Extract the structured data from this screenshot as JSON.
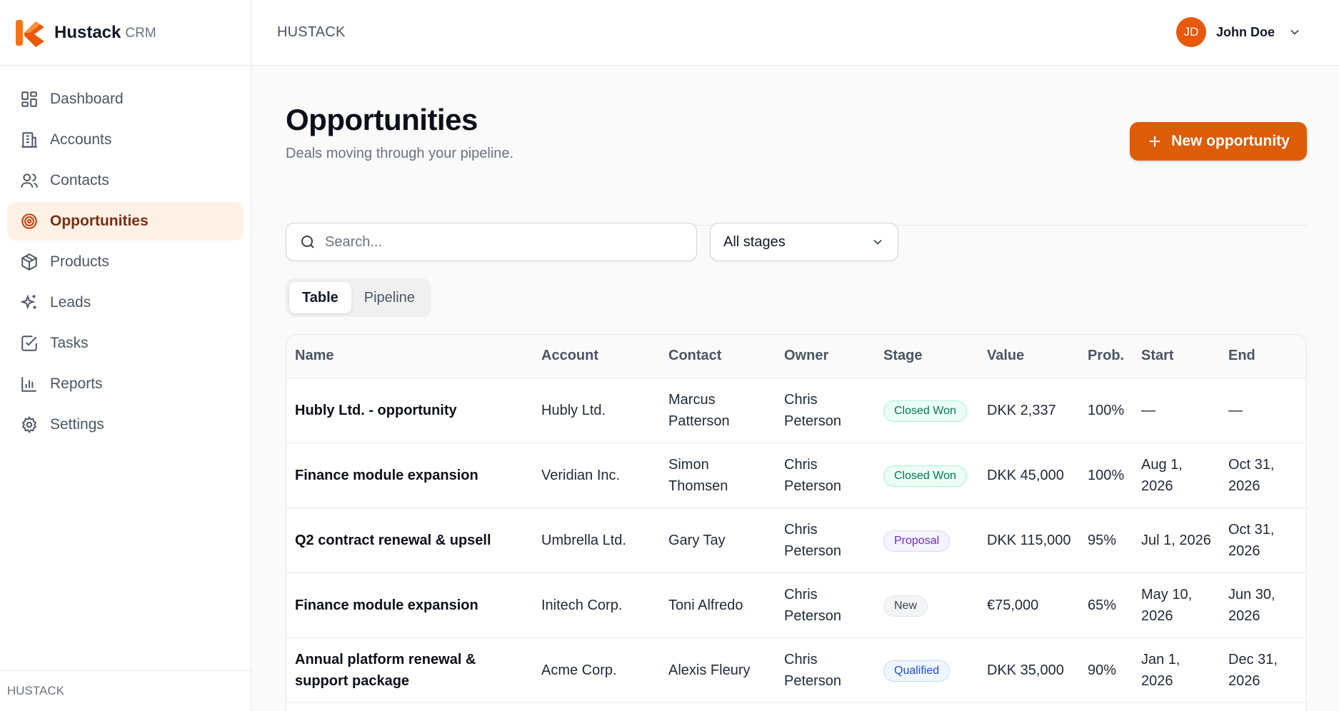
{
  "brand": {
    "name": "Hustack",
    "suffix": "CRM",
    "accent": "#EA580C"
  },
  "sidebar": {
    "items": [
      {
        "label": "Dashboard",
        "icon": "dashboard-icon"
      },
      {
        "label": "Accounts",
        "icon": "building-icon"
      },
      {
        "label": "Contacts",
        "icon": "users-icon"
      },
      {
        "label": "Opportunities",
        "icon": "target-icon",
        "active": true
      },
      {
        "label": "Products",
        "icon": "box-icon"
      },
      {
        "label": "Leads",
        "icon": "sparkles-icon"
      },
      {
        "label": "Tasks",
        "icon": "checkbox-icon"
      },
      {
        "label": "Reports",
        "icon": "bar-chart-icon"
      },
      {
        "label": "Settings",
        "icon": "gear-icon"
      }
    ],
    "footer": "HUSTACK"
  },
  "header": {
    "title": "HUSTACK",
    "user": {
      "initials": "JD",
      "name": "John Doe"
    }
  },
  "page": {
    "title": "Opportunities",
    "subtitle": "Deals moving through your pipeline.",
    "new_button": "New opportunity"
  },
  "filters": {
    "search_placeholder": "Search...",
    "stage_selected": "All stages"
  },
  "view_toggle": {
    "options": [
      "Table",
      "Pipeline"
    ],
    "active": "Table"
  },
  "table": {
    "columns": [
      "Name",
      "Account",
      "Contact",
      "Owner",
      "Stage",
      "Value",
      "Prob.",
      "Start",
      "End"
    ],
    "rows": [
      {
        "name": "Hubly Ltd. - opportunity",
        "account": "Hubly Ltd.",
        "contact": "Marcus Patterson",
        "owner": "Chris Peterson",
        "stage": "Closed Won",
        "value": "DKK 2,337",
        "prob": "100%",
        "start": "—",
        "end": "—"
      },
      {
        "name": "Finance module expansion",
        "account": "Veridian Inc.",
        "contact": "Simon Thomsen",
        "owner": "Chris Peterson",
        "stage": "Closed Won",
        "value": "DKK 45,000",
        "prob": "100%",
        "start": "Aug 1, 2026",
        "end": "Oct 31, 2026"
      },
      {
        "name": "Q2 contract renewal & upsell",
        "account": "Umbrella Ltd.",
        "contact": "Gary Tay",
        "owner": "Chris Peterson",
        "stage": "Proposal",
        "value": "DKK 115,000",
        "prob": "95%",
        "start": "Jul 1, 2026",
        "end": "Oct 31, 2026"
      },
      {
        "name": "Finance module expansion",
        "account": "Initech Corp.",
        "contact": "Toni Alfredo",
        "owner": "Chris Peterson",
        "stage": "New",
        "value": "€75,000",
        "prob": "65%",
        "start": "May 10, 2026",
        "end": "Jun 30, 2026"
      },
      {
        "name": "Annual platform renewal & support package",
        "account": "Acme Corp.",
        "contact": "Alexis Fleury",
        "owner": "Chris Peterson",
        "stage": "Qualified",
        "value": "DKK 35,000",
        "prob": "90%",
        "start": "Jan 1, 2026",
        "end": "Dec 31, 2026"
      }
    ]
  }
}
